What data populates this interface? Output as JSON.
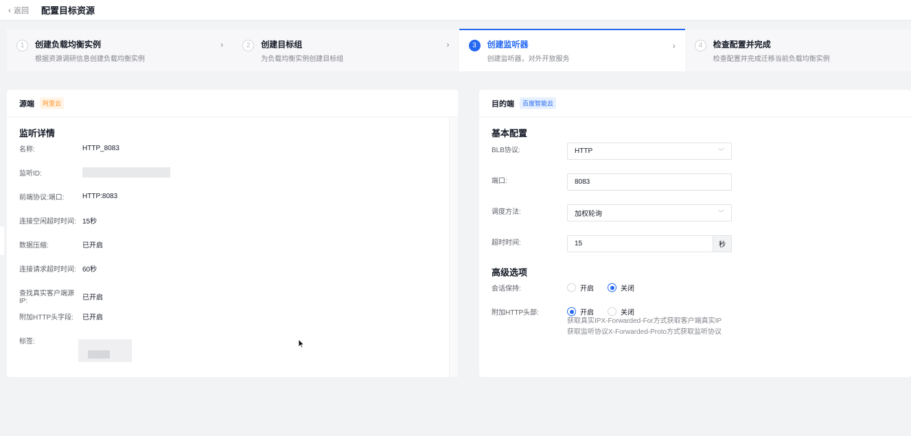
{
  "header": {
    "back_label": "返回",
    "title": "配置目标资源"
  },
  "steps": [
    {
      "num": "1",
      "title": "创建负载均衡实例",
      "desc": "根据资源调研信息创建负载均衡实例"
    },
    {
      "num": "2",
      "title": "创建目标组",
      "desc": "为负载均衡实例创建目标组"
    },
    {
      "num": "3",
      "title": "创建监听器",
      "desc": "创建监听器，对外开放服务"
    },
    {
      "num": "4",
      "title": "检查配置并完成",
      "desc": "检查配置并完成迁移当前负载均衡实例"
    }
  ],
  "source": {
    "head": "源端",
    "tag": "阿里云",
    "section": "监听详情",
    "fields": [
      {
        "label": "名称:",
        "value": "HTTP_8083"
      },
      {
        "label": "监听ID:",
        "value": ""
      },
      {
        "label": "前端协议:端口:",
        "value": "HTTP:8083"
      },
      {
        "label": "连接空闲超时时间:",
        "value": "15秒"
      },
      {
        "label": "数据压缩:",
        "value": "已开启"
      },
      {
        "label": "连接请求超时时间:",
        "value": "60秒"
      },
      {
        "label": "查找真实客户端源IP:",
        "value": "已开启"
      },
      {
        "label": "附加HTTP头字段:",
        "value": "已开启"
      },
      {
        "label": "标签:",
        "value": ""
      }
    ]
  },
  "target": {
    "head": "目的端",
    "tag": "百度智能云",
    "basic_section": "基本配置",
    "protocol_label": "BLB协议:",
    "protocol_value": "HTTP",
    "port_label": "端口:",
    "port_value": "8083",
    "schedule_label": "调度方法:",
    "schedule_value": "加权轮询",
    "timeout_label": "超时时间:",
    "timeout_value": "15",
    "timeout_unit": "秒",
    "advanced_section": "高级选项",
    "session_label": "会话保持:",
    "session_on": "开启",
    "session_off": "关闭",
    "session_selected": "关闭",
    "header_label": "附加HTTP头部:",
    "header_on": "开启",
    "header_off": "关闭",
    "header_selected": "开启",
    "hint_1": "获取真实IPX-Forwarded-For方式获取客户端真实IP",
    "hint_2": "获取监听协议X-Forwarded-Proto方式获取监听协议"
  },
  "colors": {
    "primary": "#2468f2",
    "orange": "#ff9326"
  }
}
